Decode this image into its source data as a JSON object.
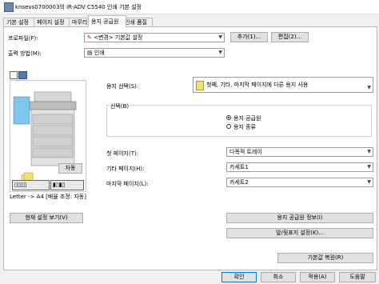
{
  "window": {
    "title": "knsevs0700003의 iR-ADV C5540 인쇄 기본 설정"
  },
  "tabs": [
    "기본 설정",
    "페이지 설정",
    "마무리",
    "용지 공급원",
    "인쇄 품질"
  ],
  "profile": {
    "label": "프로파일(F):",
    "value": "<변경> 기본값 설정",
    "add_label": "추가(1)...",
    "edit_label": "편집(2)..."
  },
  "output": {
    "label": "출력 방법(M):",
    "value": "인쇄"
  },
  "preview": {
    "auto_label": "자동",
    "status_text": "Letter -> A4 [배율 조정: 자동]",
    "view_settings_label": "현재 설정 보기(V)"
  },
  "paper_select": {
    "label": "용지 선택(S):",
    "value": "첫째, 기타, 마지막 페이지에 다른 용지 사용"
  },
  "selection": {
    "group_label": "선택(B)",
    "options": [
      "용지 공급원",
      "용지 종류"
    ],
    "selected_index": 0
  },
  "first_page": {
    "label": "첫 페이지(T):",
    "value": "다목적 트레이"
  },
  "other_pages": {
    "label": "기타 페이지(H):",
    "value": "카세트1"
  },
  "last_page": {
    "label": "마지막 페이지(L):",
    "value": "카세트2"
  },
  "buttons": {
    "source_info": "용지 공급원 정보(I)",
    "front_back_cover": "앞/뒷표지 설정(K)...",
    "restore_defaults": "기본값 복원(R)",
    "ok": "확인",
    "cancel": "취소",
    "apply": "적용(A)",
    "help": "도움말"
  }
}
